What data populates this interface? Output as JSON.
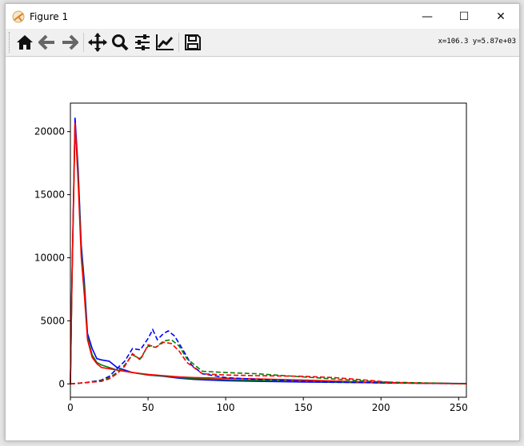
{
  "window": {
    "title": "Figure 1",
    "minimize": "—",
    "maximize": "☐",
    "close": "✕"
  },
  "toolbar": {
    "buttons": [
      "home-icon",
      "back-icon",
      "forward-icon",
      "pan-icon",
      "zoom-icon",
      "configure-subplots-icon",
      "edit-axes-icon",
      "save-icon"
    ],
    "coords": "x=106.3 y=5.87e+03"
  },
  "chart_data": {
    "type": "line",
    "title": "",
    "xlabel": "",
    "ylabel": "",
    "xlim": [
      0,
      255
    ],
    "ylim": [
      -1060,
      22260
    ],
    "xticks": [
      0,
      50,
      100,
      150,
      200,
      250
    ],
    "xtick_labels": [
      "0",
      "50",
      "100",
      "150",
      "200",
      "250"
    ],
    "yticks": [
      0,
      5000,
      10000,
      15000,
      20000
    ],
    "ytick_labels": [
      "0",
      "5000",
      "10000",
      "15000",
      "20000"
    ],
    "series": [
      {
        "name": "blue-solid",
        "color": "#0000ff",
        "style": "solid",
        "x": [
          0,
          1,
          3,
          5,
          7,
          9,
          11,
          14,
          17,
          20,
          25,
          30,
          40,
          50,
          60,
          70,
          80,
          100,
          120,
          150,
          200,
          255
        ],
        "y": [
          0,
          8000,
          21100,
          17000,
          11000,
          8000,
          4000,
          2800,
          2000,
          1900,
          1800,
          1300,
          900,
          700,
          600,
          450,
          350,
          250,
          200,
          150,
          80,
          30
        ]
      },
      {
        "name": "green-solid",
        "color": "#008000",
        "style": "solid",
        "x": [
          0,
          1,
          3,
          5,
          7,
          9,
          11,
          14,
          17,
          20,
          25,
          30,
          40,
          50,
          60,
          70,
          80,
          100,
          120,
          150,
          200,
          255
        ],
        "y": [
          0,
          7800,
          20500,
          16500,
          10500,
          7500,
          3700,
          2300,
          1700,
          1500,
          1300,
          1100,
          900,
          700,
          620,
          500,
          420,
          330,
          280,
          200,
          90,
          20
        ]
      },
      {
        "name": "red-solid",
        "color": "#ff0000",
        "style": "solid",
        "x": [
          0,
          1,
          3,
          5,
          7,
          9,
          11,
          14,
          17,
          20,
          25,
          30,
          40,
          50,
          60,
          70,
          80,
          100,
          120,
          150,
          200,
          255
        ],
        "y": [
          0,
          8200,
          20700,
          16000,
          10000,
          7000,
          3500,
          2100,
          1600,
          1300,
          1200,
          1100,
          900,
          750,
          650,
          550,
          500,
          450,
          400,
          300,
          100,
          20
        ]
      },
      {
        "name": "blue-dashed",
        "color": "#0000ff",
        "style": "dashed",
        "x": [
          0,
          10,
          20,
          25,
          30,
          35,
          40,
          45,
          50,
          53,
          56,
          60,
          63,
          67,
          72,
          78,
          85,
          100,
          120,
          150,
          200,
          255
        ],
        "y": [
          0,
          100,
          300,
          600,
          1200,
          1800,
          2800,
          2700,
          3600,
          4300,
          3500,
          4000,
          4200,
          3800,
          2800,
          1500,
          800,
          500,
          350,
          200,
          80,
          10
        ]
      },
      {
        "name": "green-dashed",
        "color": "#008000",
        "style": "dashed",
        "x": [
          0,
          10,
          20,
          25,
          30,
          35,
          40,
          45,
          50,
          55,
          60,
          65,
          70,
          75,
          85,
          100,
          120,
          150,
          180,
          200,
          255
        ],
        "y": [
          0,
          100,
          250,
          500,
          900,
          1500,
          2300,
          2000,
          3000,
          2900,
          3400,
          3500,
          3000,
          2000,
          1000,
          900,
          800,
          550,
          300,
          150,
          10
        ]
      },
      {
        "name": "red-dashed",
        "color": "#ff0000",
        "style": "dashed",
        "x": [
          0,
          10,
          20,
          25,
          30,
          35,
          40,
          45,
          50,
          55,
          60,
          65,
          70,
          75,
          85,
          100,
          120,
          150,
          170,
          190,
          210,
          255
        ],
        "y": [
          0,
          100,
          200,
          400,
          800,
          1400,
          2400,
          1900,
          3100,
          2900,
          3300,
          3200,
          2600,
          1700,
          800,
          700,
          650,
          600,
          500,
          300,
          80,
          0
        ]
      }
    ]
  }
}
